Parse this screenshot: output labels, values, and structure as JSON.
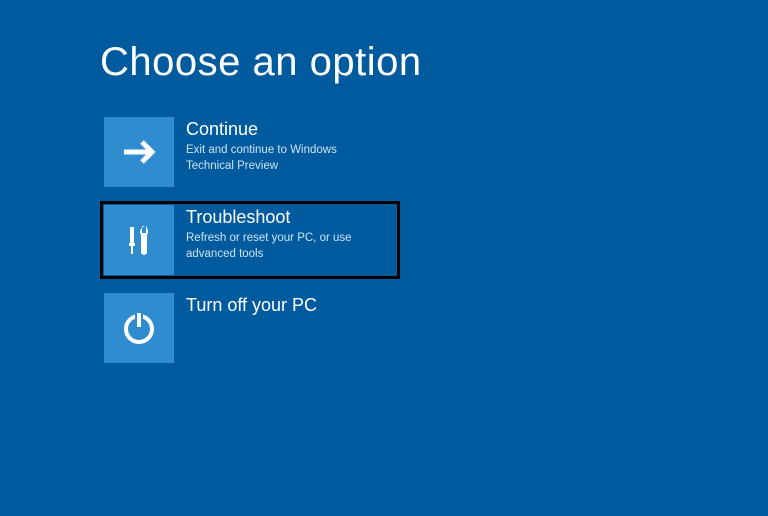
{
  "page": {
    "title": "Choose an option"
  },
  "options": {
    "continue": {
      "title": "Continue",
      "desc": "Exit and continue to Windows Technical Preview"
    },
    "troubleshoot": {
      "title": "Troubleshoot",
      "desc": "Refresh or reset your PC, or use advanced tools"
    },
    "turnoff": {
      "title": "Turn off your PC",
      "desc": ""
    }
  }
}
